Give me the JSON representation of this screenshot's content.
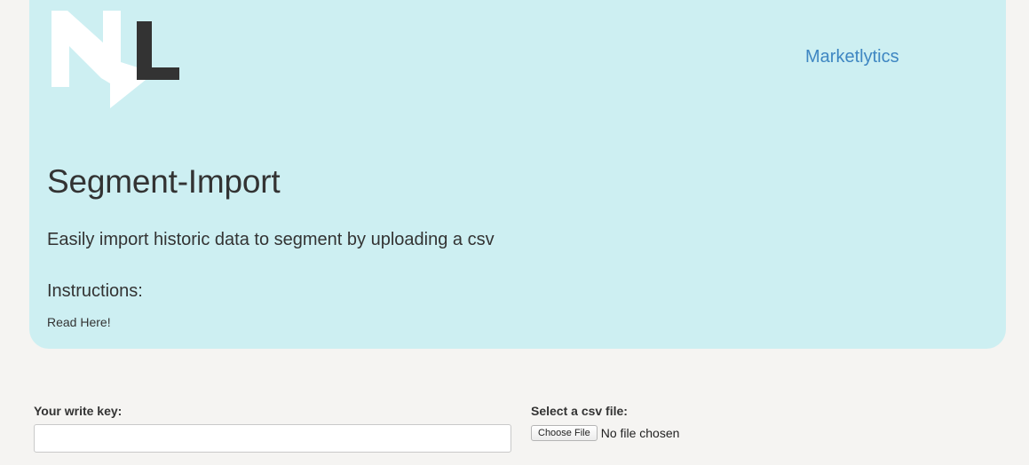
{
  "header": {
    "logo_alt": "ML",
    "brand_link": "Marketlytics"
  },
  "hero": {
    "title": "Segment-Import",
    "subtitle": "Easily import historic data to segment by uploading a csv",
    "instructions_heading": "Instructions:",
    "instructions_link": "Read Here!"
  },
  "form": {
    "write_key": {
      "label": "Your write key:",
      "value": "",
      "placeholder": ""
    },
    "csv_file": {
      "label": "Select a csv file:",
      "button_label": "Choose File",
      "status_text": "No file chosen"
    }
  },
  "colors": {
    "jumbotron_bg": "#cdeff2",
    "page_bg": "#f5f4f2",
    "link": "#3e86c2",
    "text": "#333333"
  }
}
